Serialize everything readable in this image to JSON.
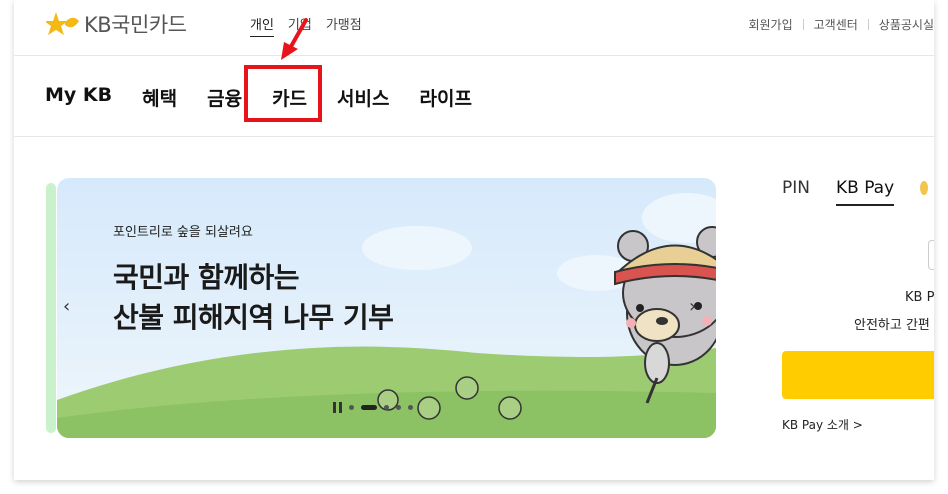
{
  "header": {
    "logo_text": "KB국민카드",
    "segments": [
      "개인",
      "기업",
      "가맹점"
    ],
    "utility": [
      "회원가입",
      "고객센터",
      "상품공시실"
    ]
  },
  "gnb": {
    "items": [
      "My KB",
      "혜택",
      "금융",
      "카드",
      "서비스",
      "라이프"
    ],
    "highlighted": "카드"
  },
  "banner": {
    "kicker": "포인트리로 숲을 되살려요",
    "title_line1": "국민과 함께하는",
    "title_line2": "산불 피해지역 나무 기부",
    "prev": "‹",
    "next": "›",
    "dots": 6,
    "active_dot": 1
  },
  "pay_panel": {
    "tabs": [
      "PIN",
      "KB Pay"
    ],
    "active_tab": "KB Pay",
    "desc1": "KB P",
    "desc2": "안전하고 간편",
    "intro_link": "KB Pay 소개 >"
  },
  "colors": {
    "highlight": "#e8141b",
    "kb_yellow": "#ffcc00",
    "logo_yellow": "#f5b915"
  }
}
